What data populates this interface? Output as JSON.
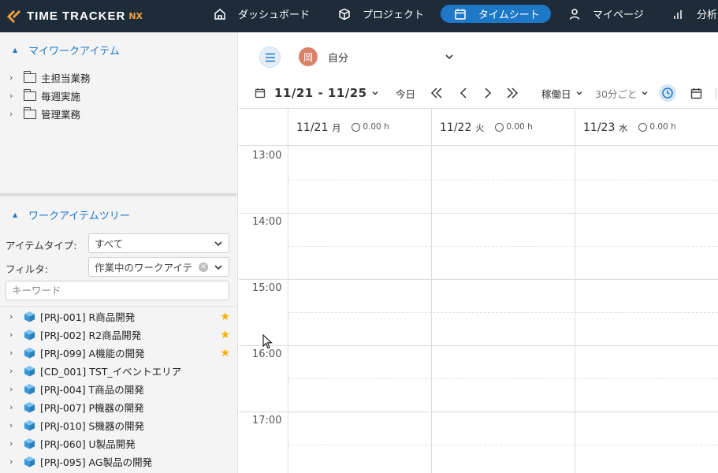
{
  "app": {
    "logo_text": "TIME TRACKER",
    "logo_suffix": "NX"
  },
  "nav": {
    "dashboard": "ダッシュボード",
    "project": "プロジェクト",
    "timesheet": "タイムシート",
    "mypage": "マイページ",
    "analytics": "分析"
  },
  "left": {
    "my_items_title": "マイワークアイテム",
    "my_items": [
      {
        "label": "主担当業務"
      },
      {
        "label": "毎週実施"
      },
      {
        "label": "管理業務"
      }
    ],
    "tree_title": "ワークアイテムツリー",
    "item_type_label": "アイテムタイプ:",
    "item_type_value": "すべて",
    "filter_label": "フィルタ:",
    "filter_value": "作業中のワークアイテ",
    "keyword_placeholder": "キーワード",
    "items": [
      {
        "label": "[PRJ-001] R商品開発",
        "starred": true
      },
      {
        "label": "[PRJ-002] R2商品開発",
        "starred": true
      },
      {
        "label": "[PRJ-099] A機能の開発",
        "starred": true
      },
      {
        "label": "[CD_001] TST_イベントエリア",
        "starred": false
      },
      {
        "label": "[PRJ-004] T商品の開発",
        "starred": false
      },
      {
        "label": "[PRJ-007] P機器の開発",
        "starred": false
      },
      {
        "label": "[PRJ-010] S機器の開発",
        "starred": false
      },
      {
        "label": "[PRJ-060] U製品開発",
        "starred": false
      },
      {
        "label": "[PRJ-095] AG製品の開発",
        "starred": false
      }
    ]
  },
  "main": {
    "avatar_char": "岡",
    "user_select": "自分",
    "date_range": "11/21 - 11/25",
    "today": "今日",
    "workday": "稼働日",
    "interval": "30分ごと",
    "days": [
      {
        "date": "11/21",
        "weekday": "月",
        "hours": "0.00 h"
      },
      {
        "date": "11/22",
        "weekday": "火",
        "hours": "0.00 h"
      },
      {
        "date": "11/23",
        "weekday": "水",
        "hours": "0.00 h"
      }
    ],
    "times": [
      "13:00",
      "14:00",
      "15:00",
      "16:00",
      "17:00"
    ]
  },
  "colors": {
    "nav_bg": "#1e2c3a",
    "accent": "#1e78c8",
    "star": "#f4b000",
    "cube": "#4aa3df"
  }
}
